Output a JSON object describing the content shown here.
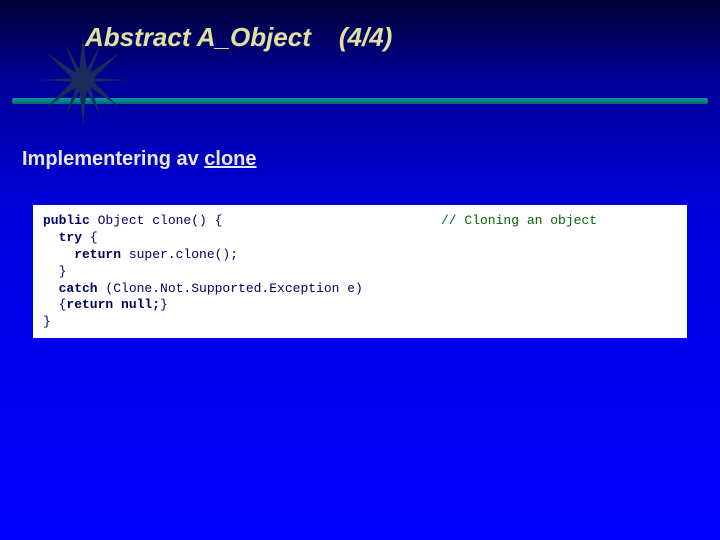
{
  "header": {
    "title": "Abstract   A_Object",
    "counter": "(4/4)"
  },
  "subtitle": {
    "prefix": "Implementering av ",
    "emphasized": "clone"
  },
  "code": {
    "comment": "// Cloning an object",
    "lines": {
      "l1a": "public",
      "l1b": " Object clone() {",
      "l2a": "  try",
      "l2b": " {",
      "l3a": "    return",
      "l3b": " super.clone();",
      "l4": "  }",
      "l5a": "  catch",
      "l5b": " (Clone.Not.Supported.Exception e)",
      "l6a": "  {",
      "l6b": "return null;",
      "l6c": "}",
      "l7": "}"
    }
  }
}
